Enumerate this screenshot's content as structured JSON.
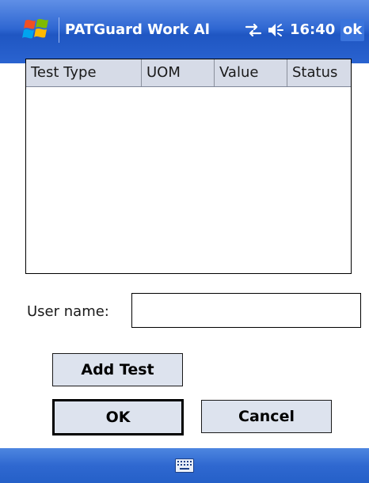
{
  "title_bar": {
    "app_title": "PATGuard Work Al",
    "clock": "16:40",
    "ok_label": "ok",
    "start_icon": "windows-flag-icon",
    "connectivity_icon": "connectivity-arrows-icon",
    "volume_icon": "speaker-volume-icon"
  },
  "list": {
    "columns": [
      "Test Type",
      "UOM",
      "Value",
      "Status"
    ],
    "rows": []
  },
  "form": {
    "user_name_label": "User name:",
    "user_name_value": ""
  },
  "buttons": {
    "add_test": "Add Test",
    "ok": "OK",
    "cancel": "Cancel"
  },
  "menu_bar": {
    "input_icon": "keyboard-icon"
  },
  "colors": {
    "title_bar": "#2f67d2",
    "menu_bar": "#2f68d0",
    "list_header": "#d6dbe7",
    "button_face": "#dde3ee"
  }
}
